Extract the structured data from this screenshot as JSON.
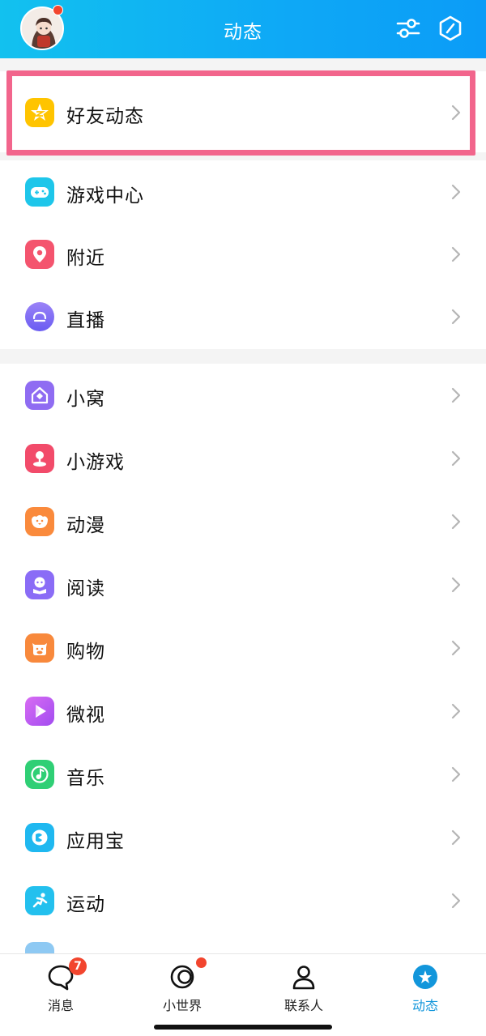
{
  "header": {
    "title": "动态",
    "filter_icon": "sliders-icon",
    "settings_icon": "hexagon-icon",
    "avatar_has_dot": true
  },
  "sections": [
    {
      "items": [
        {
          "label": "好友动态",
          "icon": "friend-feed-star-icon",
          "color": "#ffc400"
        }
      ]
    },
    {
      "items": [
        {
          "label": "游戏中心",
          "icon": "gamepad-icon",
          "color": "#1ec6ea"
        },
        {
          "label": "附近",
          "icon": "location-pin-icon",
          "color": "#f4546e"
        },
        {
          "label": "直播",
          "icon": "live-icon",
          "color": "#7b6cf6"
        }
      ]
    },
    {
      "items": [
        {
          "label": "小窝",
          "icon": "home-nest-icon",
          "color": "#8f6cf2"
        },
        {
          "label": "小游戏",
          "icon": "joystick-icon",
          "color": "#f24b6a"
        },
        {
          "label": "动漫",
          "icon": "anime-chick-icon",
          "color": "#fa8a3c"
        },
        {
          "label": "阅读",
          "icon": "reading-icon",
          "color": "#8a6cf6"
        },
        {
          "label": "购物",
          "icon": "shopping-cow-icon",
          "color": "#f8893c"
        },
        {
          "label": "微视",
          "icon": "weishi-play-icon",
          "color": "#c45cf2"
        },
        {
          "label": "音乐",
          "icon": "music-note-icon",
          "color": "#2fcf75"
        },
        {
          "label": "应用宝",
          "icon": "app-store-icon",
          "color": "#1fb8f0"
        },
        {
          "label": "运动",
          "icon": "running-icon",
          "color": "#23c0ee"
        }
      ]
    }
  ],
  "tabbar": [
    {
      "label": "消息",
      "icon": "message-bubble-icon",
      "badge": "7",
      "active": false
    },
    {
      "label": "小世界",
      "icon": "small-world-icon",
      "badge": "",
      "dot": true,
      "active": false
    },
    {
      "label": "联系人",
      "icon": "contacts-person-icon",
      "badge": "",
      "active": false
    },
    {
      "label": "动态",
      "icon": "feed-star-icon",
      "badge": "",
      "active": true
    }
  ],
  "colors": {
    "accent": "#0ea8f6",
    "highlight_border": "#f2658c",
    "badge": "#f2452e"
  }
}
